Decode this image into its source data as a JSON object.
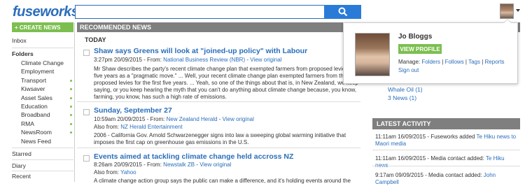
{
  "header": {
    "logo": "fuseworks",
    "search_value": "",
    "search_placeholder": ""
  },
  "sidebar": {
    "create_news": "+ CREATE NEWS",
    "inbox": "Inbox",
    "folders_label": "Folders",
    "folders": [
      "Climate Change",
      "Employment",
      "Transport",
      "Kiwsaver",
      "Asset Sales",
      "Education",
      "Broadband",
      "RMA",
      "NewsRoom",
      "News Feed"
    ],
    "starred": "Starred",
    "diary": "Diary",
    "recent": "Recent"
  },
  "main": {
    "header": "RECOMMENDED NEWS",
    "today": "TODAY",
    "articles": [
      {
        "title": "Shaw says Greens will look at \"joined-up policy\" with Labour",
        "time": "3:27pm 20/09/2015 - From: ",
        "source": "National Business Review (NBR)",
        "sep": " - ",
        "view": "View original",
        "snippet": "Mr Shaw describes the party's recent climate change plan that exempted farmers from proposed levies for five years as a \"pragmatic move.\" ... Well, your recent climate change plan exempted farmers from the proposed levies for the first five years. ... Yeah, so one of the things about that is, in New Zealand, we keep saying, or you keep hearing the myth that you can't do anything about climate change because, you know, farming, you know, has such a high rate of emissions."
      },
      {
        "title": "Sunday, September 27",
        "time": "10:59am 20/09/2015 - From: ",
        "source": "New Zealand Herald",
        "sep": " - ",
        "view": "View original",
        "also_label": "Also from: ",
        "also": "NZ Herald Entertainment",
        "snippet": "2006 - California Gov. Arnold Schwarzenegger signs into law a sweeping global warming initiative that imposes the first cap on greenhouse gas emissions in the U.S."
      },
      {
        "title": "Events aimed at tackling climate change held accross NZ",
        "time": "8:26am 20/09/2015 - From: ",
        "source": "Newstalk ZB",
        "sep": " - ",
        "view": "View original",
        "also_label": "Also from: ",
        "also": "Yahoo",
        "snippet": "A climate change action group says the public can make a difference, and it's holding events around the"
      }
    ]
  },
  "right": {
    "whale": "Whale Oil (1)",
    "three_news": "3 News (1)",
    "latest_header": "LATEST ACTIVITY",
    "activity": [
      {
        "text": "11:11am 16/09/2015 - Fuseworks added ",
        "link": "Te Hiku news to Maori media"
      },
      {
        "text": "11:11am 16/09/2015 - Media contact added: ",
        "link": "Te Hiku news"
      },
      {
        "text": "9:17am 09/09/2015 - Media contact added: ",
        "link": "John Campbell"
      }
    ]
  },
  "popup": {
    "name": "Jo Bloggs",
    "view_profile": "VIEW PROFILE",
    "manage_label": "Manage: ",
    "manage_links": [
      "Folders",
      "Follows",
      "Tags",
      "Reports"
    ],
    "sign_out": "Sign out"
  }
}
